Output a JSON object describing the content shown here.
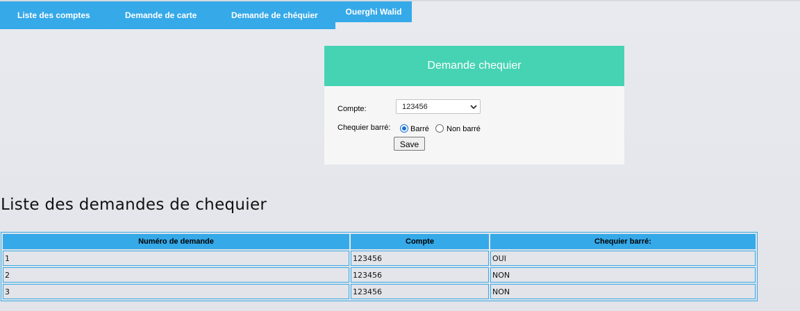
{
  "nav": {
    "items": [
      {
        "label": "Liste des comptes"
      },
      {
        "label": "Demande de carte"
      },
      {
        "label": "Demande de chéquier"
      }
    ],
    "user": "Ouerghi Walid"
  },
  "form": {
    "title": "Demande chequier",
    "compte_label": "Compte:",
    "compte_value": "123456",
    "barre_label": "Chequier barré:",
    "options": [
      {
        "label": "Barré",
        "checked": true
      },
      {
        "label": "Non barré",
        "checked": false
      }
    ],
    "save_label": "Save"
  },
  "list": {
    "title": "Liste des demandes de chequier",
    "columns": [
      "Numéro de demande",
      "Compte",
      "Chequier barré:"
    ],
    "rows": [
      [
        "1",
        "123456",
        "OUI"
      ],
      [
        "2",
        "123456",
        "NON"
      ],
      [
        "3",
        "123456",
        "NON"
      ]
    ]
  },
  "colors": {
    "nav_blue": "#36a9e8",
    "card_header_green": "#46d3b3",
    "radio_blue": "#1a6fd8"
  }
}
